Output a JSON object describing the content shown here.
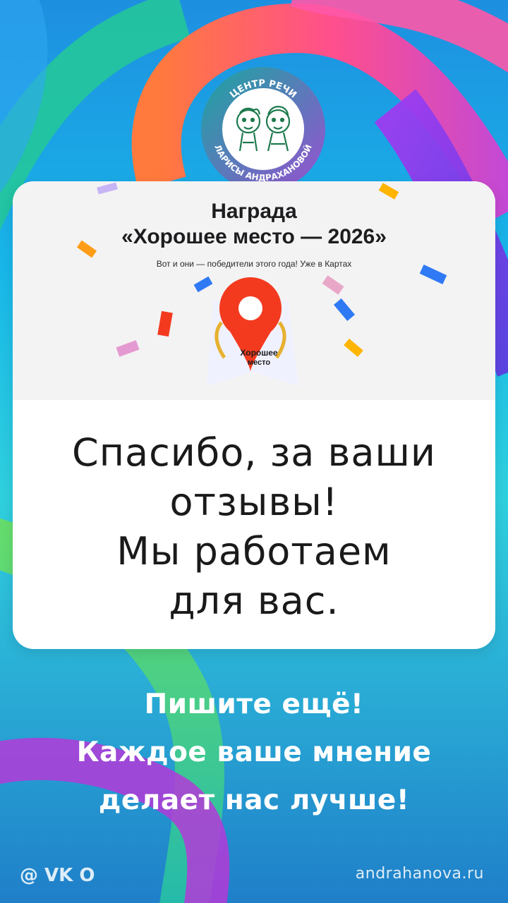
{
  "logo": {
    "text_top": "ЦЕНТР РЕЧИ",
    "text_bottom": "ЛАРИСЫ АНДРАХАНОВОЙ"
  },
  "award": {
    "title_line1": "Награда",
    "title_line2": "«Хорошее место — 2026»",
    "subtitle": "Вот и они — победители этого года! Уже в Картах",
    "badge_text_line1": "Хорошее",
    "badge_text_line2": "место"
  },
  "thanks": {
    "line1": "Спасибо, за ваши",
    "line2": "отзывы!",
    "line3": "Мы работаем",
    "line4": "для вас."
  },
  "bottom": {
    "line1": "Пишите ещё!",
    "line2": "Каждое ваше мнение",
    "line3": "делает нас лучше!"
  },
  "footer": {
    "social": "@ VK O",
    "site": "andrahanova.ru"
  },
  "colors": {
    "award_bg": "#f3f3f4",
    "pin_red": "#f33a1f",
    "bottom_text": "#ffffff"
  }
}
